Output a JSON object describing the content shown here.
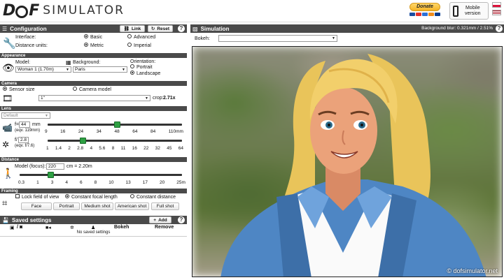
{
  "header": {
    "logo_mark": "D",
    "logo_mark_end": "F",
    "logo_text": "SIMULATOR",
    "donate_label": "Donate",
    "mobile_line1": "Mobile",
    "mobile_line2": "version"
  },
  "config": {
    "title": "Configuration",
    "link_label": "Link",
    "reset_label": "Reset",
    "interface_label": "Interface:",
    "interface_basic": "Basic",
    "interface_advanced": "Advanced",
    "units_label": "Distance units:",
    "units_metric": "Metric",
    "units_imperial": "Imperial"
  },
  "appearance": {
    "title": "Appearance",
    "model_label": "Model:",
    "model_value": "Woman 1 (1.70m)",
    "background_label": "Background:",
    "background_value": "Paris",
    "orientation_label": "Orientation:",
    "portrait": "Portrait",
    "landscape": "Landscape"
  },
  "camera": {
    "title": "Camera",
    "sensor_size": "Sensor size",
    "camera_model": "Camera model",
    "sensor_value": "1\"",
    "crop_label": "crop:",
    "crop_value": "2.71x"
  },
  "lens": {
    "title": "Lens",
    "preset_value": "Default",
    "focal_prefix": "f=",
    "focal_value": "44",
    "focal_unit": "mm",
    "focal_equiv": "(eqv. 119mm)",
    "focal_ticks": [
      "9",
      "16",
      "24",
      "34",
      "48",
      "64",
      "84",
      "110mm"
    ],
    "focal_position": 0.52,
    "aperture_prefix": "f/",
    "aperture_value": "2.8",
    "aperture_equiv": "(eqv. f/7.6)",
    "aperture_ticks": [
      "1",
      "1.4",
      "2",
      "2.8",
      "4",
      "5.6",
      "8",
      "11",
      "16",
      "22",
      "32",
      "45",
      "64"
    ],
    "aperture_position": 0.25
  },
  "distance": {
    "title": "Distance",
    "label": "Model (focus):",
    "value": "220",
    "readout": "cm = 2.20m",
    "ticks": [
      "0.3",
      "1",
      "3",
      "4",
      "6",
      "8",
      "10",
      "13",
      "17",
      "20",
      "25m"
    ],
    "position": 0.18
  },
  "framing": {
    "title": "Framing",
    "lock_label": "Lock field of view",
    "constant_focal": "Constant focal length",
    "constant_distance": "Constant distance",
    "buttons": [
      "Face",
      "Portrait",
      "Medium shot",
      "American shot",
      "Full shot"
    ]
  },
  "saved": {
    "title": "Saved settings",
    "add_label": "Add",
    "col_sep": "/",
    "col_bokeh": "Bokeh",
    "col_remove": "Remove",
    "empty_text": "No saved settings"
  },
  "simulation": {
    "title": "Simulation",
    "blur_readout": "Background blur: 0.321mm / 2.51%",
    "bokeh_label": "Bokeh:",
    "bokeh_value": "",
    "watermark": "© dofsimulator.net"
  },
  "colors": {
    "bar": "#4a4a4a",
    "slider_thumb": "#2ea043",
    "jacket": "#4e86c4",
    "hair": "#f2cf6b",
    "skin": "#eba27a"
  }
}
